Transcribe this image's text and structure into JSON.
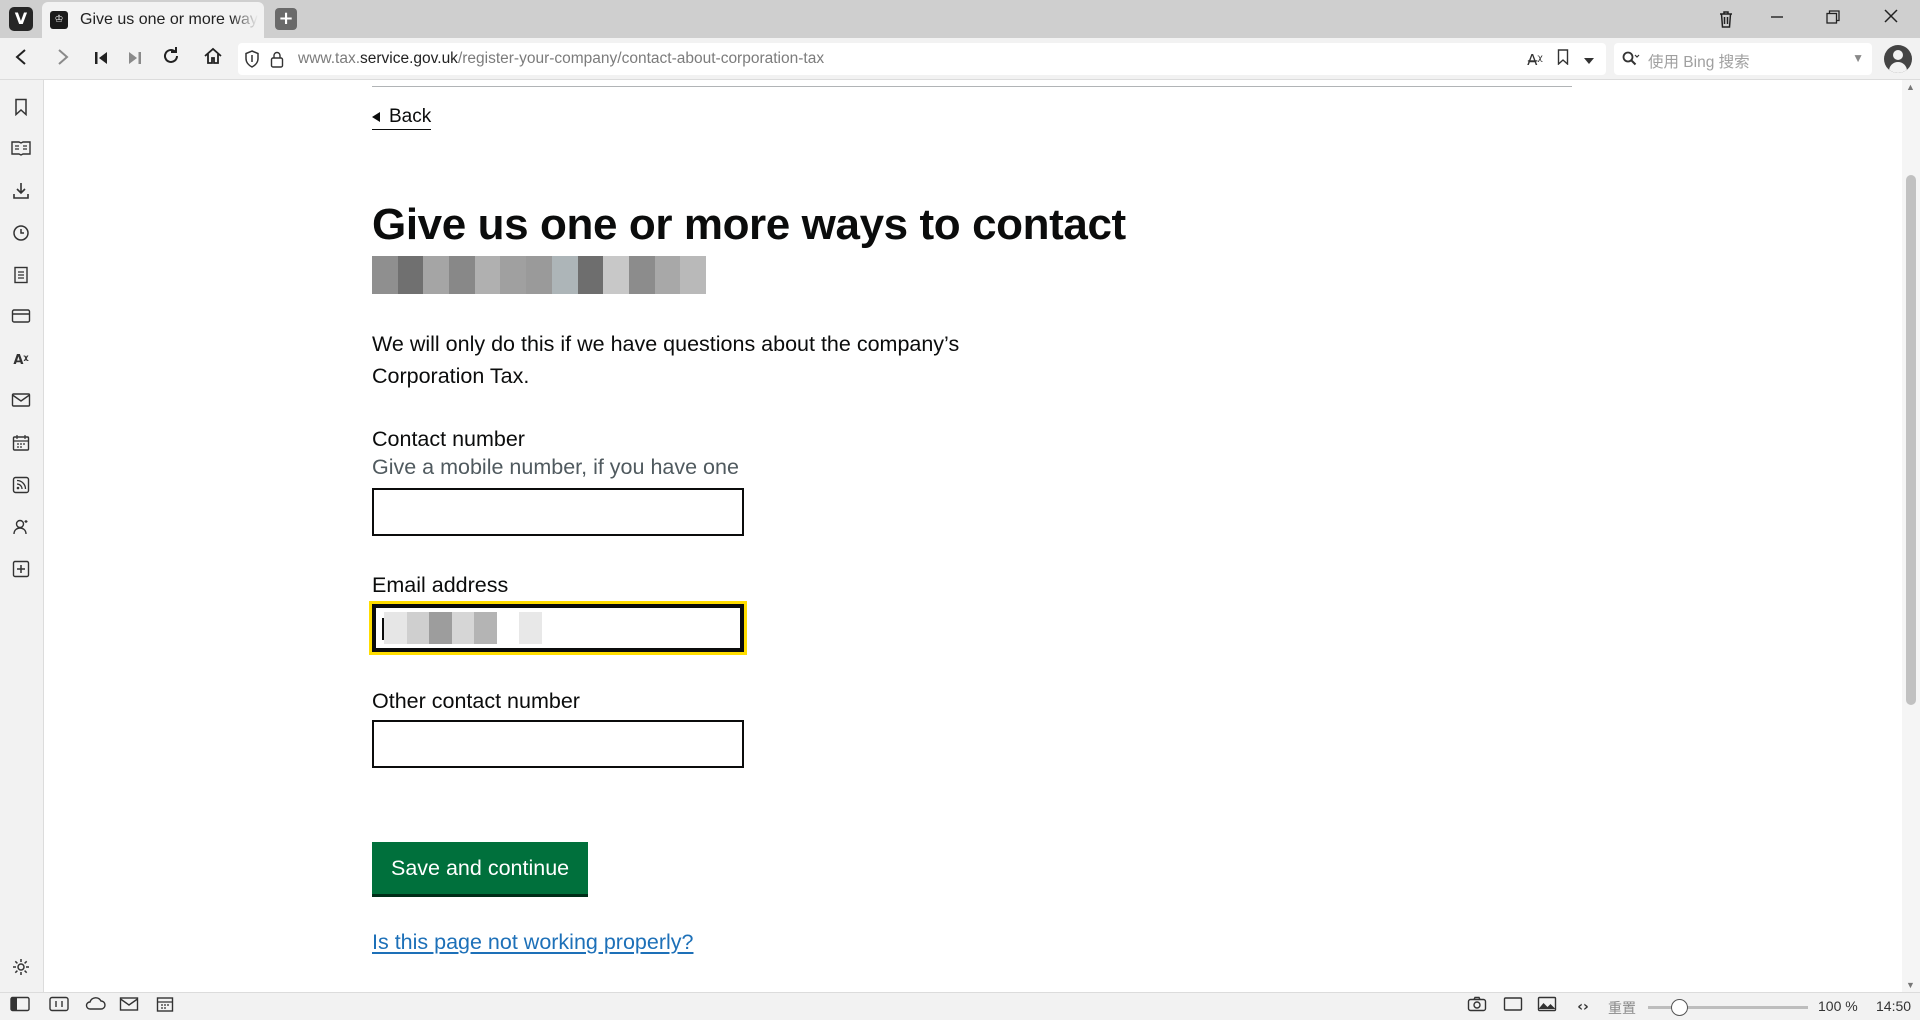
{
  "browser": {
    "tab_title": "Give us one or more ways to contact",
    "new_tab_label": "+",
    "url_host_prefix": "www.tax.",
    "url_domain": "service.gov.uk",
    "url_path": "/register-your-company/contact-about-corporation-tax",
    "search_placeholder": "使用 Bing 搜索",
    "status_reset_label": "重置",
    "zoom_level": "100 %",
    "zoom_fraction": 0.2,
    "clock": "14:50"
  },
  "page": {
    "back_link": "Back",
    "title": "Give us one or more ways to contact",
    "lead_text": "We will only do this if we have questions about the company’s Corporation Tax.",
    "fields": [
      {
        "label": "Contact number",
        "hint": "Give a mobile number, if you have one",
        "value": ""
      },
      {
        "label": "Email address",
        "hint": "",
        "value": ""
      },
      {
        "label": "Other contact number",
        "hint": "",
        "value": ""
      }
    ],
    "submit_button": "Save and continue",
    "problem_link": "Is this page not working properly?"
  },
  "icons": {
    "browser_logo": "vivaldi-icon",
    "tab_favicon": "govuk-crown-icon",
    "trash": "trash-icon",
    "minimize": "minimize-icon",
    "restore": "restore-icon",
    "close": "close-icon",
    "nav": [
      "back-icon",
      "forward-icon",
      "rewind-icon",
      "fast-forward-icon",
      "reload-icon",
      "home-icon"
    ],
    "sidebar": [
      "bookmarks-icon",
      "reading-list-icon",
      "downloads-icon",
      "history-icon",
      "notes-icon",
      "window-panel-icon",
      "translate-icon",
      "mail-icon",
      "calendar-icon",
      "feeds-icon",
      "contacts-icon",
      "add-panel-icon"
    ],
    "statusbar": [
      "panel-toggle-icon",
      "tab-tiling-icon",
      "sync-icon",
      "mail-status-icon",
      "calendar-status-icon",
      "capture-icon",
      "window-icon",
      "images-icon",
      "page-actions-icon"
    ]
  },
  "colors": {
    "govuk_green": "#00703c",
    "govuk_link": "#1d70b8",
    "focus_yellow": "#ffdd00",
    "text": "#0b0c0c",
    "hint": "#505a5f"
  }
}
